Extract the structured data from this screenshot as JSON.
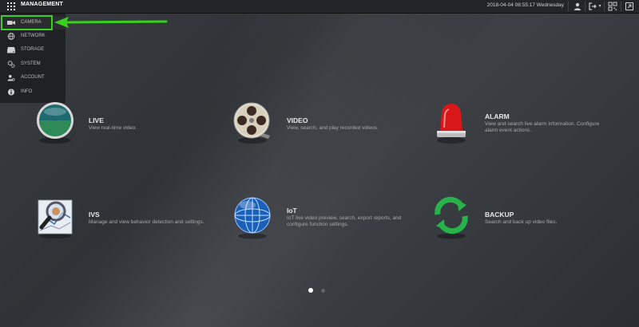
{
  "topbar": {
    "title": "MANAGEMENT",
    "datetime": "2018-04-04 08:55:17 Wednesday"
  },
  "menu": {
    "items": [
      {
        "label": "CAMERA",
        "icon": "camera-icon"
      },
      {
        "label": "NETWORK",
        "icon": "globe-icon"
      },
      {
        "label": "STORAGE",
        "icon": "storage-icon"
      },
      {
        "label": "SYSTEM",
        "icon": "gears-icon"
      },
      {
        "label": "ACCOUNT",
        "icon": "user-gear-icon"
      },
      {
        "label": "INFO",
        "icon": "info-icon"
      }
    ]
  },
  "tiles": {
    "live": {
      "name": "LIVE",
      "desc": "View real-time video."
    },
    "video": {
      "name": "VIDEO",
      "desc": "View, search, and play recorded videos."
    },
    "alarm": {
      "name": "ALARM",
      "desc": "View and search live alarm information. Configure alarm event actions."
    },
    "ivs": {
      "name": "IVS",
      "desc": "Manage and view behavior detection and settings."
    },
    "iot": {
      "name": "IoT",
      "desc": "IoT live video preview, search, export reports, and configure function settings."
    },
    "backup": {
      "name": "BACKUP",
      "desc": "Search and back up video files."
    }
  },
  "colors": {
    "highlight": "#38d11f",
    "active_dot": "#ffffff",
    "inactive_dot": "#666666"
  },
  "pager": {
    "pages": 2,
    "current": 1
  }
}
